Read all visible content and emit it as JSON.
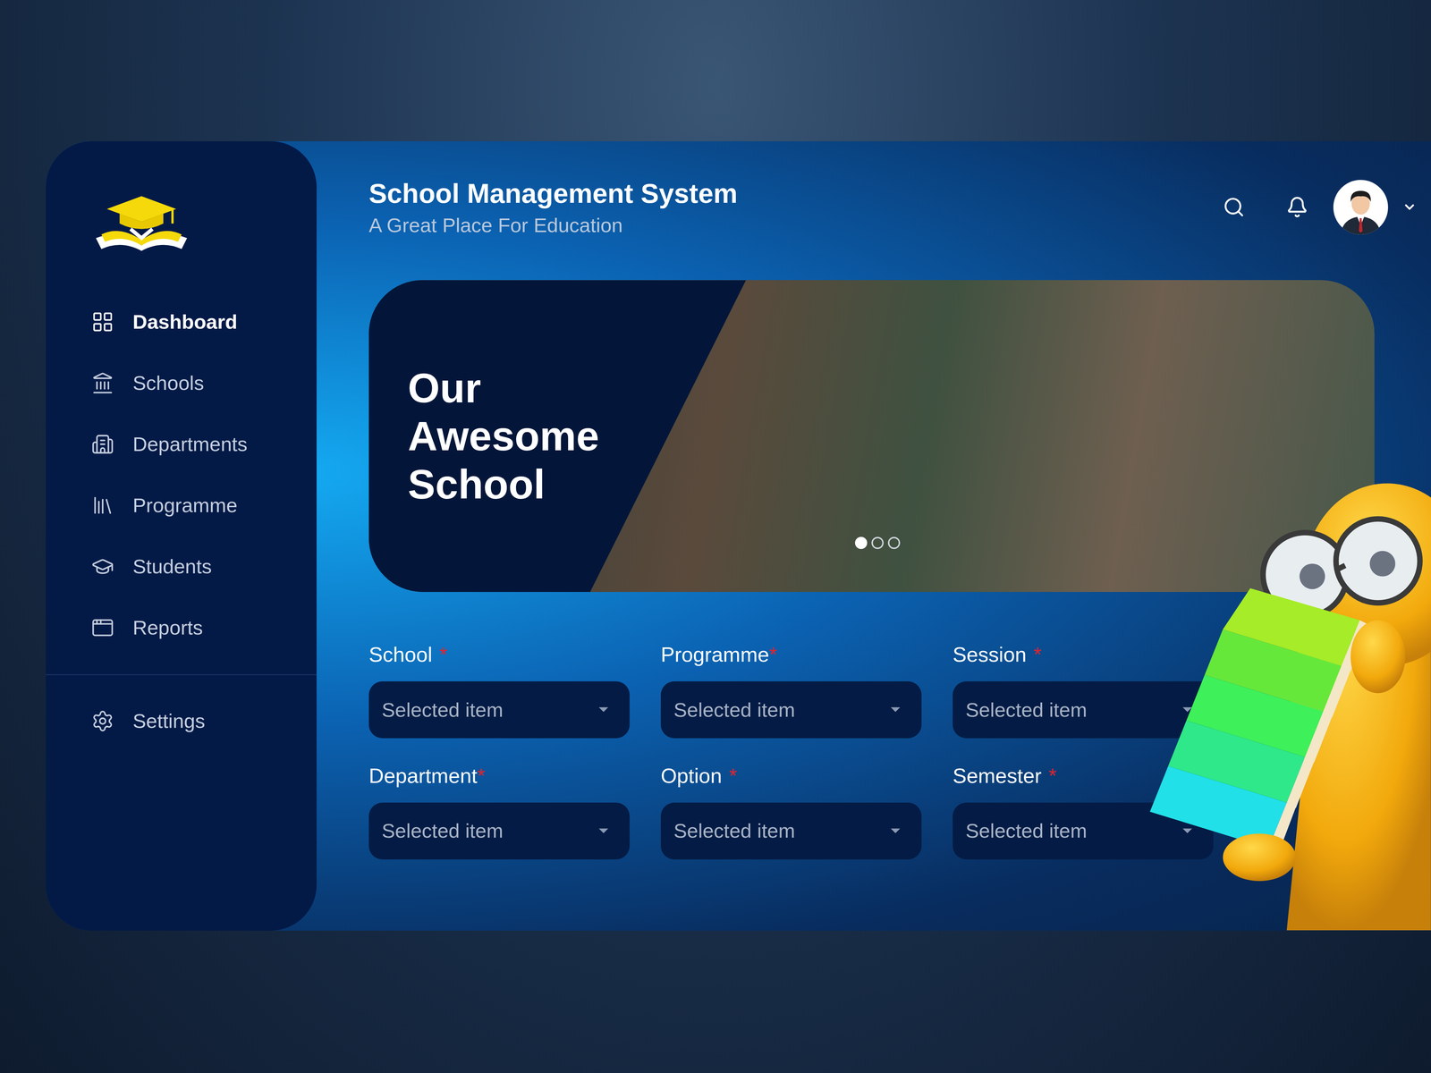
{
  "header": {
    "title": "School Management System",
    "subtitle": "A Great Place For Education"
  },
  "sidebar": {
    "items": [
      {
        "label": "Dashboard",
        "selected": true
      },
      {
        "label": "Schools",
        "selected": false
      },
      {
        "label": "Departments",
        "selected": false
      },
      {
        "label": "Programme",
        "selected": false
      },
      {
        "label": "Students",
        "selected": false
      },
      {
        "label": "Reports",
        "selected": false
      }
    ],
    "footer_items": [
      {
        "label": "Settings",
        "selected": false
      }
    ]
  },
  "banner": {
    "title_lines": [
      "Our",
      "Awesome",
      "School"
    ],
    "dots": [
      {
        "selected": true
      },
      {
        "selected": false
      },
      {
        "selected": false
      }
    ]
  },
  "form": {
    "fields": [
      {
        "label": "School",
        "mark": "*",
        "spaced": true,
        "placeholder": "Selected item"
      },
      {
        "label": "Programme",
        "mark": "*",
        "spaced": false,
        "placeholder": "Selected item"
      },
      {
        "label": "Session",
        "mark": "*",
        "spaced": true,
        "placeholder": "Selected item"
      },
      {
        "label": "Department",
        "mark": "*",
        "spaced": false,
        "placeholder": "Selected item"
      },
      {
        "label": "Option",
        "mark": "*",
        "spaced": true,
        "placeholder": "Selected item"
      },
      {
        "label": "Semester",
        "mark": "*",
        "spaced": true,
        "placeholder": "Selected item"
      }
    ]
  }
}
